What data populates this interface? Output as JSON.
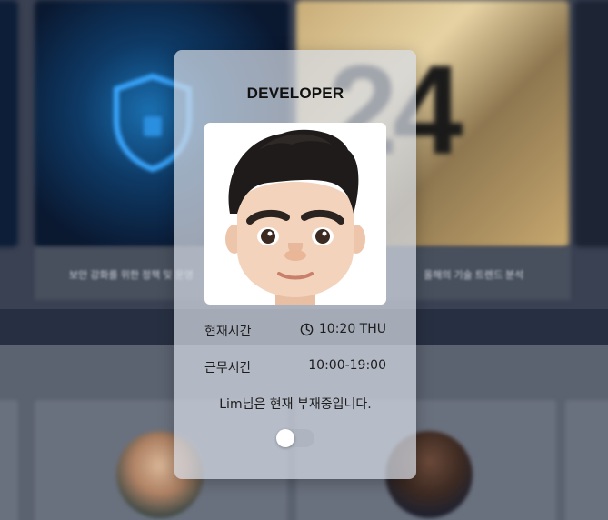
{
  "background": {
    "caption_left": "보안 강화를 위한 정책 및 운영",
    "caption_right": "올해의 기술 트렌드 분석"
  },
  "card": {
    "title": "DEVELOPER",
    "avatar_icon": "memoji-avatar",
    "current_time_label": "현재시간",
    "current_time_icon": "clock-icon",
    "current_time_value": "10:20 THU",
    "work_hours_label": "근무시간",
    "work_hours_value": "10:00-19:00",
    "status_message": "Lim님은 현재 부재중입니다.",
    "toggle_on": false
  },
  "colors": {
    "panel": "#d6dbe4",
    "text": "#1d1d1d"
  }
}
